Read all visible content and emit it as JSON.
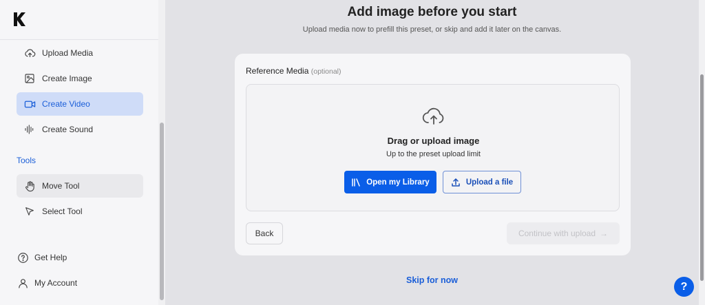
{
  "sidebar": {
    "logo_icon": "k-logo-icon",
    "items": [
      {
        "label": "Upload Media",
        "icon": "cloud-upload-icon"
      },
      {
        "label": "Create Image",
        "icon": "image-icon"
      },
      {
        "label": "Create Video",
        "icon": "video-icon",
        "active": true
      },
      {
        "label": "Create Sound",
        "icon": "waveform-icon"
      }
    ],
    "tools_title": "Tools",
    "tools": [
      {
        "label": "Move Tool",
        "icon": "hand-icon"
      },
      {
        "label": "Select Tool",
        "icon": "cursor-icon"
      }
    ],
    "footer": [
      {
        "label": "Get Help",
        "icon": "help-circle-icon"
      },
      {
        "label": "My Account",
        "icon": "user-icon"
      }
    ]
  },
  "main": {
    "title": "Add image before you start",
    "subtitle": "Upload media now to prefill this preset, or skip and add it later on the canvas.",
    "card": {
      "label": "Reference Media",
      "optional": "(optional)",
      "dropzone_title": "Drag or upload image",
      "dropzone_subtitle": "Up to the preset upload limit",
      "library_button": "Open my Library",
      "upload_button": "Upload a file",
      "back_button": "Back",
      "continue_button": "Continue with upload",
      "continue_arrow": "→"
    },
    "skip_link": "Skip for now"
  },
  "help_fab": "?",
  "colors": {
    "accent": "#0a5ee8",
    "active_nav_bg": "#cfdcf8",
    "page_bg": "#e2e2e6"
  }
}
